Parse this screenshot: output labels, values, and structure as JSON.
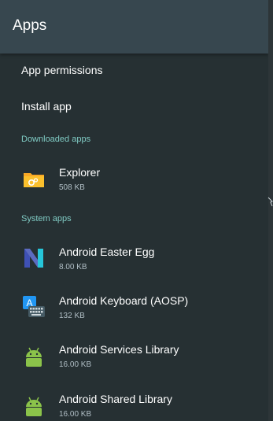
{
  "header": {
    "title": "Apps"
  },
  "items": {
    "permissions_label": "App permissions",
    "install_label": "Install app"
  },
  "sections": {
    "downloaded": "Downloaded apps",
    "system": "System apps"
  },
  "downloaded_apps": [
    {
      "name": "Explorer",
      "size": "508 KB",
      "icon": "explorer-icon"
    }
  ],
  "system_apps": [
    {
      "name": "Android Easter Egg",
      "size": "8.00 KB",
      "icon": "nougat-icon"
    },
    {
      "name": "Android Keyboard (AOSP)",
      "size": "132 KB",
      "icon": "keyboard-icon"
    },
    {
      "name": "Android Services Library",
      "size": "16.00 KB",
      "icon": "android-icon"
    },
    {
      "name": "Android Shared Library",
      "size": "16.00 KB",
      "icon": "android-icon"
    }
  ],
  "colors": {
    "header_bg": "#37474f",
    "list_bg": "#263033",
    "section_accent": "#80cbc4",
    "android_green": "#8bc34a"
  }
}
